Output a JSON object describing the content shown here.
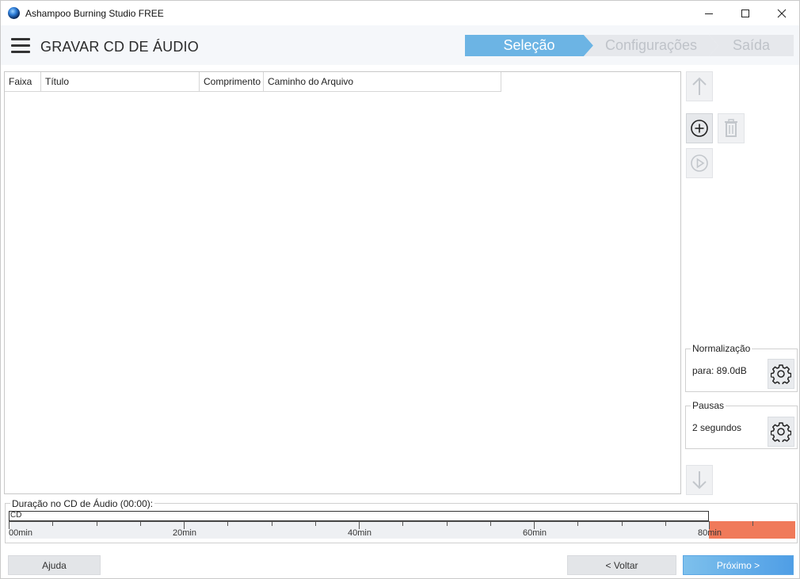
{
  "window": {
    "title": "Ashampoo Burning Studio FREE",
    "minimize_icon": "minimize-icon",
    "maximize_icon": "maximize-icon",
    "close_icon": "close-icon"
  },
  "header": {
    "menu_icon": "hamburger-menu-icon",
    "title": "GRAVAR CD DE ÁUDIO",
    "steps": [
      {
        "label": "Seleção",
        "state": "active"
      },
      {
        "label": "Configurações",
        "state": "inactive"
      },
      {
        "label": "Saída",
        "state": "inactive"
      }
    ]
  },
  "tracklist": {
    "columns": [
      "Faixa",
      "Título",
      "Comprimento",
      "Caminho do Arquivo"
    ],
    "rows": []
  },
  "toolbar": {
    "move_up_icon": "arrow-up-icon",
    "add_icon": "add-circle-icon",
    "delete_icon": "trash-icon",
    "play_icon": "play-circle-icon",
    "move_down_icon": "arrow-down-icon"
  },
  "normalization": {
    "legend": "Normalização",
    "value": "para: 89.0dB",
    "settings_icon": "gear-icon"
  },
  "pauses": {
    "legend": "Pausas",
    "value": "2 segundos",
    "settings_icon": "gear-icon"
  },
  "duration": {
    "legend": "Duração no CD de Áudio (00:00):",
    "cd_label": "CD",
    "tick_labels": [
      "00min",
      "20min",
      "40min",
      "60min",
      "80min"
    ],
    "capacity_min": 80,
    "used_min": 0,
    "overflow_color": "#f07a5a"
  },
  "footer": {
    "help_label": "Ajuda",
    "back_label": "< Voltar",
    "next_label": "Próximo >"
  },
  "colors": {
    "accent": "#6cb4e4",
    "primary_button": "#4f9ee6",
    "inactive_step": "#e6e8ec"
  }
}
